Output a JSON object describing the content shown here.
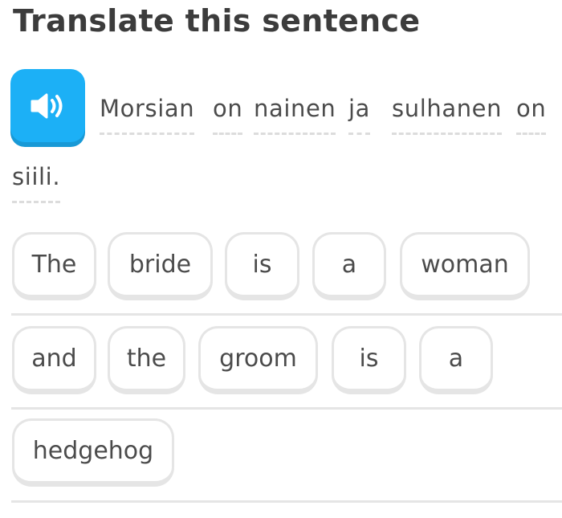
{
  "header": {
    "title": "Translate this sentence"
  },
  "prompt": {
    "speaker_icon": "speaker-icon",
    "accent_color": "#1cb0f6",
    "words": [
      "Morsian",
      "on",
      "nainen",
      "ja",
      "sulhanen",
      "on",
      "siili."
    ]
  },
  "answer": {
    "tiles": [
      "The",
      "bride",
      "is",
      "a",
      "woman",
      "and",
      "the",
      "groom",
      "is",
      "a",
      "hedgehog"
    ]
  }
}
